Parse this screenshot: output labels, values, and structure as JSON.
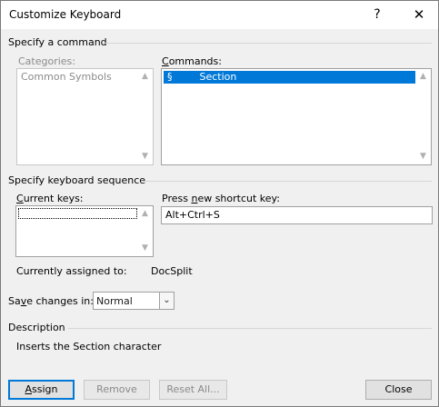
{
  "window": {
    "title": "Customize Keyboard",
    "help_label": "?",
    "close_label": "✕"
  },
  "command_section": {
    "heading": "Specify a command",
    "categories": {
      "label": "Categories:",
      "items": [
        "Common Symbols"
      ]
    },
    "commands": {
      "label": "Commands:",
      "items": [
        {
          "symbol": "§",
          "name": "Section"
        }
      ]
    }
  },
  "keyboard_section": {
    "heading": "Specify keyboard sequence",
    "current_keys_label": "Current keys:",
    "new_key_label": "Press new shortcut key:",
    "new_key_value": "Alt+Ctrl+S",
    "assigned_label": "Currently assigned to:",
    "assigned_value": "DocSplit"
  },
  "save": {
    "label": "Save changes in:",
    "value": "Normal"
  },
  "description": {
    "heading": "Description",
    "text": "Inserts the Section character"
  },
  "buttons": {
    "assign": "Assign",
    "remove": "Remove",
    "reset_all": "Reset All...",
    "close": "Close"
  },
  "colors": {
    "accent": "#0078d7",
    "selection": "#0078d7"
  },
  "icons": {
    "scroll_up": "chevron-up-icon",
    "scroll_down": "chevron-down-icon",
    "dropdown": "chevron-down-icon"
  }
}
